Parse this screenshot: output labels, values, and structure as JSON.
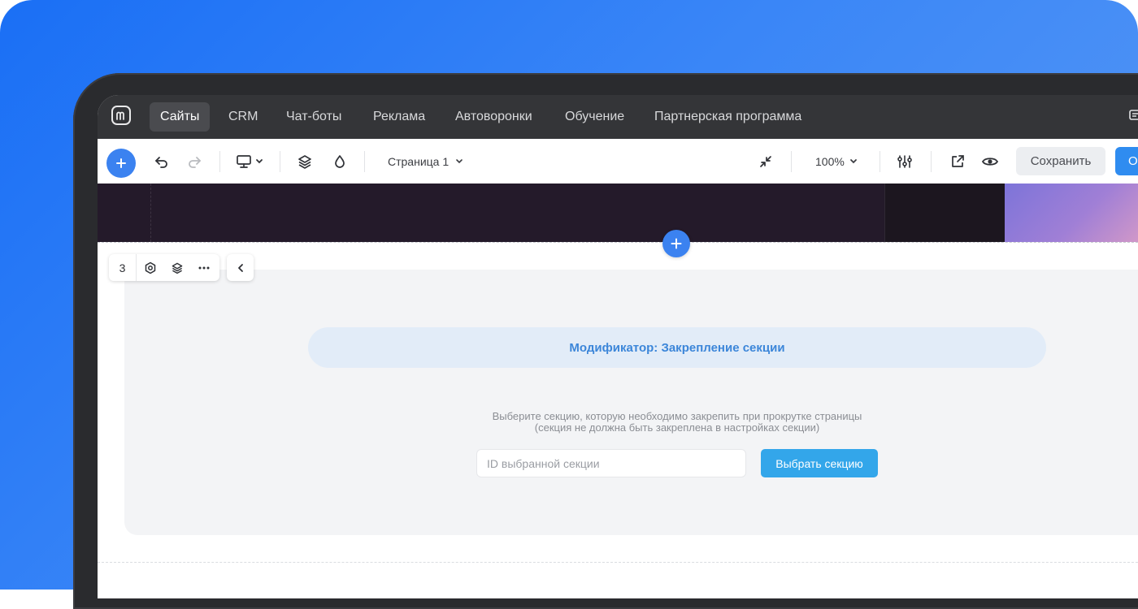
{
  "nav": {
    "items": [
      "Сайты",
      "CRM",
      "Чат-боты",
      "Реклама",
      "Автоворонки",
      "Обучение",
      "Партнерская программа"
    ],
    "active": "Сайты"
  },
  "toolbar": {
    "page_label": "Страница 1",
    "zoom_label": "100%",
    "save_label": "Сохранить",
    "publish_label": "О"
  },
  "block": {
    "number": "3",
    "modifier_title": "Модификатор: Закрепление секции",
    "description_line1": "Выберите секцию, которую необходимо закрепить при прокрутке страницы",
    "description_line2": "(секция не должна быть закреплена в настройках секции)",
    "input_placeholder": "ID выбранной секции",
    "choose_button": "Выбрать секцию"
  },
  "colors": {
    "accent": "#3b82f0",
    "button_blue": "#33a6ea",
    "nav_bg": "#343538",
    "banner_text": "#3c86d9"
  },
  "icons": [
    "logo-icon",
    "chat-icon",
    "plus-icon",
    "undo-icon",
    "redo-icon",
    "desktop-icon",
    "chevron-down-icon",
    "layers-icon",
    "drop-icon",
    "collapse-icon",
    "sliders-icon",
    "external-link-icon",
    "eye-icon",
    "settings-icon",
    "more-icon",
    "chevron-left-icon"
  ]
}
